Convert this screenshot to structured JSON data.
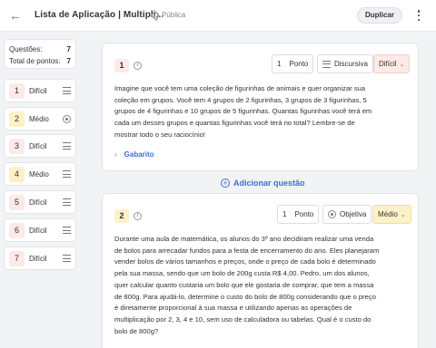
{
  "header": {
    "title": "Lista de Aplicação | Multipli...",
    "visibility": "Pública",
    "duplicate_label": "Duplicar",
    "back_icon": "arrow-left-icon",
    "menu_icon": "kebab-menu-icon"
  },
  "summary": {
    "questions_label": "Questões:",
    "questions_value": "7",
    "points_label": "Total de pontos:",
    "points_value": "7"
  },
  "nav": [
    {
      "num": "1",
      "label": "Difícil",
      "icon": "lines-icon",
      "color": "red"
    },
    {
      "num": "2",
      "label": "Médio",
      "icon": "radio-icon",
      "color": "yel"
    },
    {
      "num": "3",
      "label": "Difícil",
      "icon": "lines-icon",
      "color": "red"
    },
    {
      "num": "4",
      "label": "Médio",
      "icon": "lines-icon",
      "color": "yel"
    },
    {
      "num": "5",
      "label": "Difícil",
      "icon": "lines-icon",
      "color": "red"
    },
    {
      "num": "6",
      "label": "Difícil",
      "icon": "lines-icon",
      "color": "red"
    },
    {
      "num": "7",
      "label": "Difícil",
      "icon": "lines-icon",
      "color": "red"
    }
  ],
  "questions": [
    {
      "num": "1",
      "points_value": "1",
      "points_label": "Ponto",
      "type": "Discursiva",
      "difficulty": "Difícil",
      "text": "Imagine que você tem uma coleção de figurinhas de animais e quer organizar sua coleção em grupos. Você tem 4 grupos de 2 figurinhas, 3 grupos de 3 figurinhas, 5 grupos de 4 figurinhas e 10 grupos de 5 figurinhas. Quantas figurinhas você terá em cada um desses grupos e quantas figurinhas você terá no total? Lembre-se de mostrar todo o seu raciocínio!",
      "answer_label": "Gabarito"
    },
    {
      "num": "2",
      "points_value": "1",
      "points_label": "Ponto",
      "type": "Objetiva",
      "difficulty": "Médio",
      "text": "Durante uma aula de matemática, os alunos do 3º ano decidiram realizar uma venda de bolos para arrecadar fundos para a festa de encerramento do ano. Eles planejaram vender bolos de vários tamanhos e preços, onde o preço de cada bolo é determinado pela sua massa, sendo que um bolo de 200g custa R$ 4,00. Pedro, um dos alunos, quer calcular quanto custaria um bolo que ele gostaria de comprar, que tem a massa de 800g. Para ajudá-lo, determine o custo do bolo de 800g considerando que o preço é diretamente proporcional à sua massa e utilizando apenas as operações de multiplicação por 2, 3, 4 e 10, sem uso de calculadora ou tabelas. Qual é o custo do bolo de 800g?"
    }
  ],
  "add_question_label": "Adicionar questão"
}
